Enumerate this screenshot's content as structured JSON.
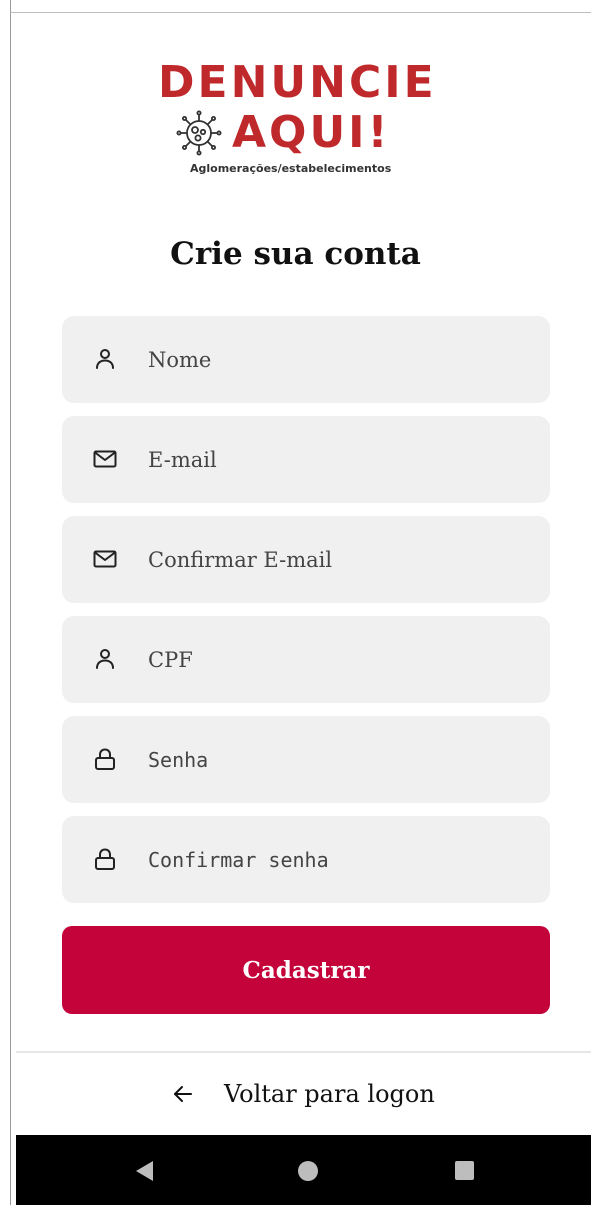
{
  "logo": {
    "line1": "DENUNCIE",
    "line2": "AQUI!",
    "subtitle": "Aglomerações/estabelecimentos",
    "icon": "virus-icon"
  },
  "title": "Crie sua conta",
  "form": {
    "name_placeholder": "Nome",
    "email_placeholder": "E-mail",
    "confirm_email_placeholder": "Confirmar E-mail",
    "cpf_placeholder": "CPF",
    "password_placeholder": "Senha",
    "confirm_password_placeholder": "Confirmar senha",
    "submit_label": "Cadastrar",
    "icons": [
      "user-icon",
      "mail-icon",
      "mail-icon",
      "user-icon",
      "lock-icon",
      "lock-icon"
    ]
  },
  "back_link": {
    "label": "Voltar para logon",
    "icon": "arrow-left-icon"
  },
  "nav_bar": {
    "icons": [
      "back-triangle-icon",
      "home-circle-icon",
      "recents-square-icon"
    ]
  },
  "colors": {
    "brand_red": "#c0292b",
    "button": "#c3033a",
    "field_bg": "#f0f0f0"
  }
}
